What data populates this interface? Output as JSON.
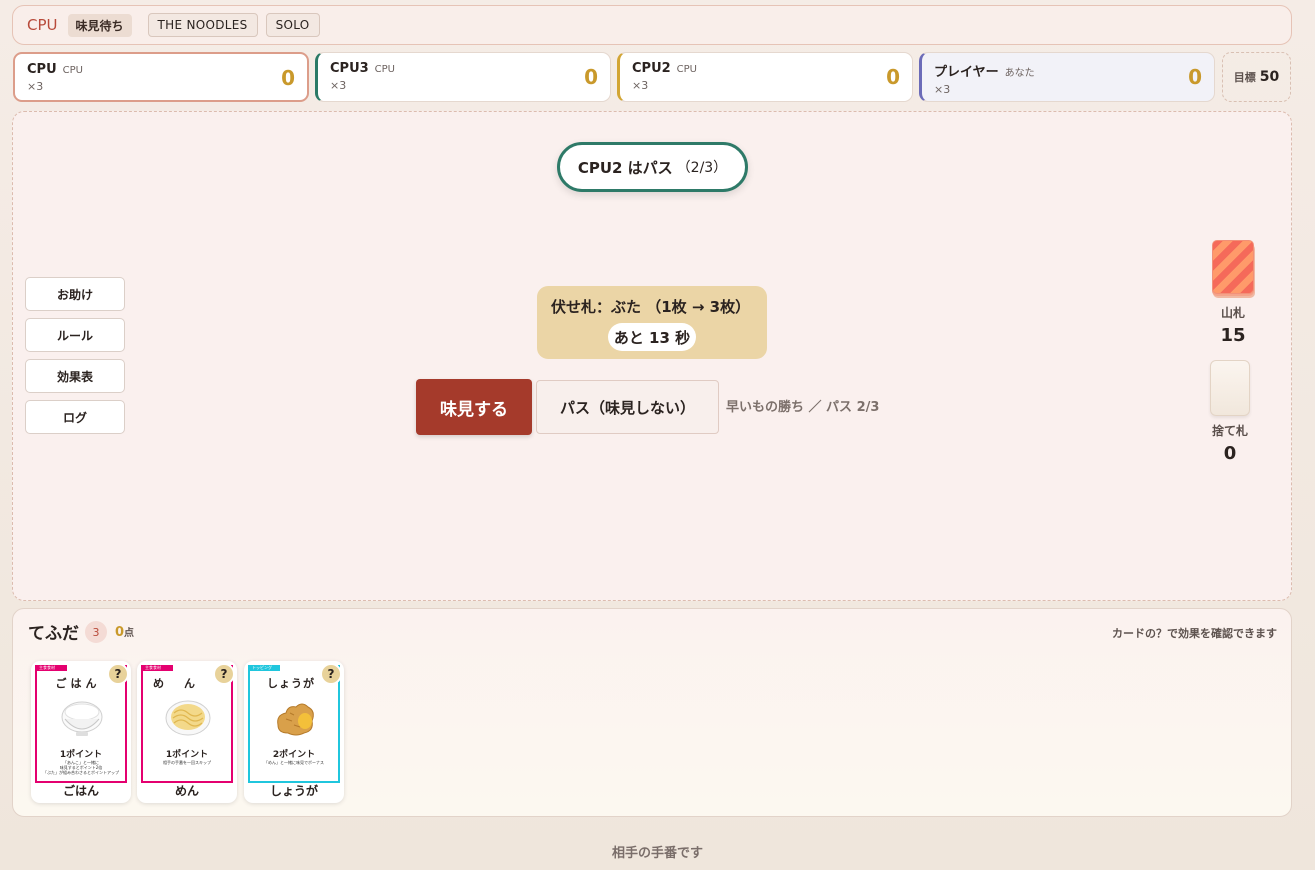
{
  "topbar": {
    "mode": "CPU",
    "status_chip": "味見待ち",
    "tag1": "THE NOODLES",
    "tag2": "SOLO"
  },
  "players": [
    {
      "name": "CPU",
      "sub": "CPU",
      "mult": "×3",
      "score": "0",
      "color": "#dc9d8a"
    },
    {
      "name": "CPU3",
      "sub": "CPU",
      "mult": "×3",
      "score": "0",
      "color": "#2a7a66"
    },
    {
      "name": "CPU2",
      "sub": "CPU",
      "mult": "×3",
      "score": "0",
      "color": "#d2a534"
    },
    {
      "name": "プレイヤー",
      "sub": "あなた",
      "mult": "×3",
      "score": "0",
      "color": "#6b6bb8"
    }
  ],
  "goal": {
    "label": "目標",
    "value": "50"
  },
  "board": {
    "status_text": "CPU2 はパス",
    "status_count": "（2/3）",
    "side_buttons": [
      "お助け",
      "ルール",
      "効果表",
      "ログ"
    ],
    "facedown_text": "伏せ札：ぶた （1枚 → 3枚）",
    "timer_text": "あと 13 秒",
    "taste_label": "味見する",
    "pass_label": "パス（味見しない）",
    "rule_note": "早いもの勝ち ／ パス 2/3",
    "deck_label": "山札",
    "deck_count": "15",
    "discard_label": "捨て札",
    "discard_count": "0"
  },
  "hand": {
    "title": "てふだ",
    "count": "3",
    "score": "0",
    "score_unit": "点",
    "hint": "カードの？で効果を確認できます",
    "cards": [
      {
        "title": "ごはん",
        "points": "1ポイント",
        "name": "ごはん",
        "desc1": "「あんこ」と一緒に",
        "desc2": "味見するとポイント2倍",
        "desc3": "「ぶた」が組み合わさるとポイントアップ",
        "icon": "rice-bowl-icon",
        "ribbon": "主食食材"
      },
      {
        "title": "めん",
        "points": "1ポイント",
        "name": "めん",
        "desc1": "相手の手番を一回スキップ",
        "desc2": "",
        "desc3": "",
        "icon": "noodles-icon",
        "ribbon": "主食食材"
      },
      {
        "title": "しょうが",
        "points": "2ポイント",
        "name": "しょうが",
        "desc1": "「めん」と一緒に味見でボーナス",
        "desc2": "",
        "desc3": "",
        "icon": "ginger-icon",
        "ribbon": "トッピング"
      }
    ]
  },
  "footer": "相手の手番です"
}
